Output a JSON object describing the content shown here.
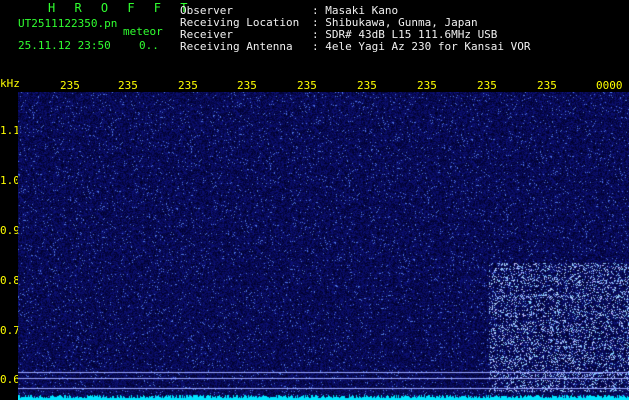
{
  "header": {
    "brand": "H R O F F T",
    "file_name": "UT2511122350.pn",
    "meteor_label": "meteor",
    "date_time": "25.11.12 23:50",
    "count": "0..",
    "info": [
      {
        "label": "Observer",
        "value": ": Masaki Kano"
      },
      {
        "label": "Receiving Location",
        "value": ": Shibukawa, Gunma, Japan"
      },
      {
        "label": "Receiver",
        "value": ": SDR# 43dB L15 111.6MHz USB"
      },
      {
        "label": "Receiving Antenna",
        "value": ": 4ele Yagi Az 230 for Kansai VOR"
      }
    ]
  },
  "time_axis": {
    "labels": [
      "235",
      "235",
      "235",
      "235",
      "235",
      "235",
      "235",
      "235",
      "235",
      "0000"
    ]
  },
  "freq_axis": {
    "unit": "kHz",
    "labels": [
      "1.1",
      "1.0",
      "0.9",
      "0.8",
      "0.7",
      "0.6"
    ]
  },
  "colors": {
    "background": "#000000",
    "spectrum_bg": "#000018",
    "noise": "#1a22c8",
    "burst": "#8fb4ff",
    "text_header": "#f0f0f0",
    "text_brand": "#30ff30",
    "axis_text": "#ffff00",
    "baseline": "#00e5ff"
  }
}
